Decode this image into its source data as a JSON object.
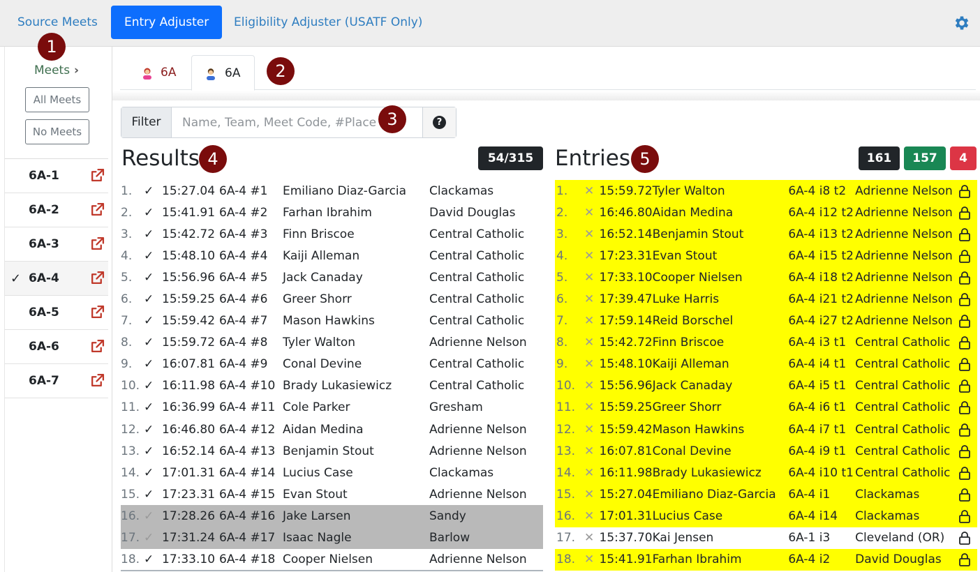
{
  "nav": {
    "source_meets": "Source Meets",
    "entry_adjuster": "Entry Adjuster",
    "eligibility_adjuster": "Eligibility Adjuster (USATF Only)"
  },
  "sidebar": {
    "heading": "Meets",
    "all_meets": "All Meets",
    "no_meets": "No Meets",
    "meets": [
      {
        "name": "6A-1",
        "selected": false
      },
      {
        "name": "6A-2",
        "selected": false
      },
      {
        "name": "6A-3",
        "selected": false
      },
      {
        "name": "6A-4",
        "selected": true
      },
      {
        "name": "6A-5",
        "selected": false
      },
      {
        "name": "6A-6",
        "selected": false
      },
      {
        "name": "6A-7",
        "selected": false
      }
    ]
  },
  "tabs": [
    {
      "label": "6A",
      "icon": "girl-icon"
    },
    {
      "label": "6A",
      "icon": "boy-icon"
    }
  ],
  "filter": {
    "label": "Filter",
    "placeholder": "Name, Team, Meet Code, #Place",
    "help": "?"
  },
  "markers": [
    "1",
    "2",
    "3",
    "4",
    "5"
  ],
  "results": {
    "title": "Results",
    "badge": "54/315",
    "rows": [
      {
        "num": "1.",
        "time": "15:27.04",
        "code": "6A-4 #1",
        "name": "Emiliano Diaz-Garcia",
        "team": "Clackamas",
        "dim": false
      },
      {
        "num": "2.",
        "time": "15:41.91",
        "code": "6A-4 #2",
        "name": "Farhan Ibrahim",
        "team": "David Douglas",
        "dim": false
      },
      {
        "num": "3.",
        "time": "15:42.72",
        "code": "6A-4 #3",
        "name": "Finn Briscoe",
        "team": "Central Catholic",
        "dim": false
      },
      {
        "num": "4.",
        "time": "15:48.10",
        "code": "6A-4 #4",
        "name": "Kaiji Alleman",
        "team": "Central Catholic",
        "dim": false
      },
      {
        "num": "5.",
        "time": "15:56.96",
        "code": "6A-4 #5",
        "name": "Jack Canaday",
        "team": "Central Catholic",
        "dim": false
      },
      {
        "num": "6.",
        "time": "15:59.25",
        "code": "6A-4 #6",
        "name": "Greer Shorr",
        "team": "Central Catholic",
        "dim": false
      },
      {
        "num": "7.",
        "time": "15:59.42",
        "code": "6A-4 #7",
        "name": "Mason Hawkins",
        "team": "Central Catholic",
        "dim": false
      },
      {
        "num": "8.",
        "time": "15:59.72",
        "code": "6A-4 #8",
        "name": "Tyler Walton",
        "team": "Adrienne Nelson",
        "dim": false
      },
      {
        "num": "9.",
        "time": "16:07.81",
        "code": "6A-4 #9",
        "name": "Conal Devine",
        "team": "Central Catholic",
        "dim": false
      },
      {
        "num": "10.",
        "time": "16:11.98",
        "code": "6A-4 #10",
        "name": "Brady Lukasiewicz",
        "team": "Central Catholic",
        "dim": false
      },
      {
        "num": "11.",
        "time": "16:36.99",
        "code": "6A-4 #11",
        "name": "Cole Parker",
        "team": "Gresham",
        "dim": false
      },
      {
        "num": "12.",
        "time": "16:46.80",
        "code": "6A-4 #12",
        "name": "Aidan Medina",
        "team": "Adrienne Nelson",
        "dim": false
      },
      {
        "num": "13.",
        "time": "16:52.14",
        "code": "6A-4 #13",
        "name": "Benjamin Stout",
        "team": "Adrienne Nelson",
        "dim": false
      },
      {
        "num": "14.",
        "time": "17:01.31",
        "code": "6A-4 #14",
        "name": "Lucius Case",
        "team": "Clackamas",
        "dim": false
      },
      {
        "num": "15.",
        "time": "17:23.31",
        "code": "6A-4 #15",
        "name": "Evan Stout",
        "team": "Adrienne Nelson",
        "dim": false
      },
      {
        "num": "16.",
        "time": "17:28.26",
        "code": "6A-4 #16",
        "name": "Jake Larsen",
        "team": "Sandy",
        "dim": true
      },
      {
        "num": "17.",
        "time": "17:31.24",
        "code": "6A-4 #17",
        "name": "Isaac Nagle",
        "team": "Barlow",
        "dim": true
      },
      {
        "num": "18.",
        "time": "17:33.10",
        "code": "6A-4 #18",
        "name": "Cooper Nielsen",
        "team": "Adrienne Nelson",
        "dim": false
      }
    ]
  },
  "entries": {
    "title": "Entries",
    "badges": {
      "total": "161",
      "green": "157",
      "red": "4"
    },
    "rows": [
      {
        "num": "1.",
        "time": "15:59.72",
        "name": "Tyler Walton",
        "code": "6A-4 i8 t2",
        "team": "Adrienne Nelson",
        "highlight": true
      },
      {
        "num": "2.",
        "time": "16:46.80",
        "name": "Aidan Medina",
        "code": "6A-4 i12 t2",
        "team": "Adrienne Nelson",
        "highlight": true
      },
      {
        "num": "3.",
        "time": "16:52.14",
        "name": "Benjamin Stout",
        "code": "6A-4 i13 t2",
        "team": "Adrienne Nelson",
        "highlight": true
      },
      {
        "num": "4.",
        "time": "17:23.31",
        "name": "Evan Stout",
        "code": "6A-4 i15 t2",
        "team": "Adrienne Nelson",
        "highlight": true
      },
      {
        "num": "5.",
        "time": "17:33.10",
        "name": "Cooper Nielsen",
        "code": "6A-4 i18 t2",
        "team": "Adrienne Nelson",
        "highlight": true
      },
      {
        "num": "6.",
        "time": "17:39.47",
        "name": "Luke Harris",
        "code": "6A-4 i21 t2",
        "team": "Adrienne Nelson",
        "highlight": true
      },
      {
        "num": "7.",
        "time": "17:59.14",
        "name": "Reid Borschel",
        "code": "6A-4 i27 t2",
        "team": "Adrienne Nelson",
        "highlight": true
      },
      {
        "num": "8.",
        "time": "15:42.72",
        "name": "Finn Briscoe",
        "code": "6A-4 i3 t1",
        "team": "Central Catholic",
        "highlight": true
      },
      {
        "num": "9.",
        "time": "15:48.10",
        "name": "Kaiji Alleman",
        "code": "6A-4 i4 t1",
        "team": "Central Catholic",
        "highlight": true
      },
      {
        "num": "10.",
        "time": "15:56.96",
        "name": "Jack Canaday",
        "code": "6A-4 i5 t1",
        "team": "Central Catholic",
        "highlight": true
      },
      {
        "num": "11.",
        "time": "15:59.25",
        "name": "Greer Shorr",
        "code": "6A-4 i6 t1",
        "team": "Central Catholic",
        "highlight": true
      },
      {
        "num": "12.",
        "time": "15:59.42",
        "name": "Mason Hawkins",
        "code": "6A-4 i7 t1",
        "team": "Central Catholic",
        "highlight": true
      },
      {
        "num": "13.",
        "time": "16:07.81",
        "name": "Conal Devine",
        "code": "6A-4 i9 t1",
        "team": "Central Catholic",
        "highlight": true
      },
      {
        "num": "14.",
        "time": "16:11.98",
        "name": "Brady Lukasiewicz",
        "code": "6A-4 i10 t1",
        "team": "Central Catholic",
        "highlight": true
      },
      {
        "num": "15.",
        "time": "15:27.04",
        "name": "Emiliano Diaz-Garcia",
        "code": "6A-4 i1",
        "team": "Clackamas",
        "highlight": true
      },
      {
        "num": "16.",
        "time": "17:01.31",
        "name": "Lucius Case",
        "code": "6A-4 i14",
        "team": "Clackamas",
        "highlight": true
      },
      {
        "num": "17.",
        "time": "15:37.70",
        "name": "Kai Jensen",
        "code": "6A-1 i3",
        "team": "Cleveland (OR)",
        "highlight": false
      },
      {
        "num": "18.",
        "time": "15:41.91",
        "name": "Farhan Ibrahim",
        "code": "6A-4 i2",
        "team": "David Douglas",
        "highlight": true
      }
    ]
  },
  "colors": {
    "primary": "#0d6efd",
    "link": "#2e7dc0",
    "marker": "#7a0c0c",
    "highlight": "#ffff00",
    "dim_row": "#b9b9b9",
    "external_link": "#c0392b"
  }
}
